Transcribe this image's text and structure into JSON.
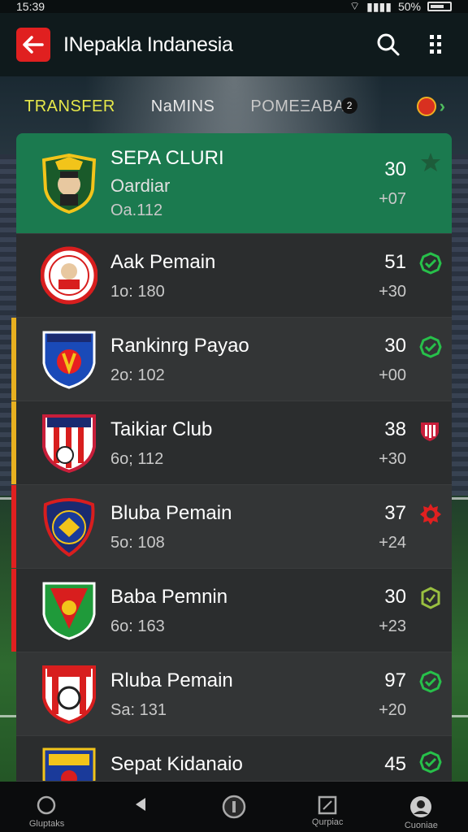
{
  "status_bar": {
    "time": "15:39",
    "battery": "50%"
  },
  "header": {
    "title": "INepakla Indanesia"
  },
  "tabs": [
    {
      "label": "TRANSFER"
    },
    {
      "label": "NaMINS"
    },
    {
      "label": "POMEΞABA",
      "badge": "2"
    }
  ],
  "colors": {
    "accent_green": "#1b7a4f",
    "accent_red": "#e02020",
    "tab_active": "#e6e84a",
    "status_green": "#27c04a"
  },
  "list": [
    {
      "name": "SEPA CLURI",
      "subtitle": "Oardiar",
      "code": "Oa.112",
      "score": "30",
      "delta": "+07",
      "status_icon": "star-icon"
    },
    {
      "name": "Aak Pemain",
      "code": "1o: 180",
      "score": "51",
      "delta": "+30",
      "status_icon": "check-icon"
    },
    {
      "name": "Rankinrg Payao",
      "code": "2o: 102",
      "score": "30",
      "delta": "+00",
      "status_icon": "check-icon"
    },
    {
      "name": "Taikiar Club",
      "code": "6o; 112",
      "score": "38",
      "delta": "+30",
      "status_icon": "club-badge-icon"
    },
    {
      "name": "Bluba Pemain",
      "code": "5o: 108",
      "score": "37",
      "delta": "+24",
      "status_icon": "gear-icon"
    },
    {
      "name": "Baba Pemnin",
      "code": "6o: 163",
      "score": "30",
      "delta": "+23",
      "status_icon": "shield-icon"
    },
    {
      "name": "Rluba Pemain",
      "code": "Sa: 131",
      "score": "97",
      "delta": "+20",
      "status_icon": "check-icon"
    },
    {
      "name": "Sepat Kidanaio",
      "score": "45",
      "status_icon": "check-icon"
    }
  ],
  "bottom_nav": [
    {
      "label": "Gluptaks",
      "icon": "search-icon"
    },
    {
      "label": "",
      "icon": "back-triangle-icon"
    },
    {
      "label": "",
      "icon": "info-icon"
    },
    {
      "label": "Qurpiac",
      "icon": "square-icon"
    },
    {
      "label": "Cuoniae",
      "icon": "profile-icon"
    }
  ]
}
